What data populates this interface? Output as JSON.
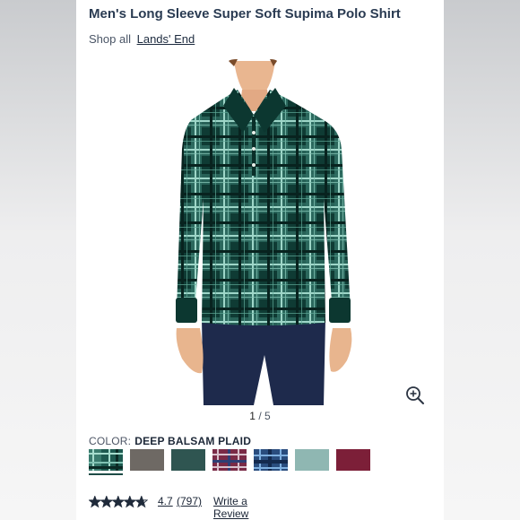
{
  "product": {
    "title": "Men's Long Sleeve Super Soft Supima Polo Shirt",
    "shop_prefix": "Shop all",
    "brand": "Lands' End"
  },
  "gallery": {
    "current": "1",
    "separator": "/",
    "total": "5"
  },
  "color": {
    "label": "COLOR:",
    "selected": "DEEP BALSAM PLAID",
    "swatches": [
      {
        "name": "deep-balsam-plaid",
        "color": "#1e5a50",
        "selected": true
      },
      {
        "name": "heather-brown",
        "color": "#6e6964"
      },
      {
        "name": "deep-balsam",
        "color": "#2f5551"
      },
      {
        "name": "burgundy-plaid",
        "color": "#7a2a46"
      },
      {
        "name": "navy-plaid",
        "color": "#2a4d7e"
      },
      {
        "name": "sea-green",
        "color": "#8fb7b2"
      },
      {
        "name": "rich-burgundy",
        "color": "#7c1f38"
      }
    ]
  },
  "reviews": {
    "rating_value": "4.7",
    "count": "(797)",
    "write_label": "Write a Review",
    "stars": 4.7
  }
}
